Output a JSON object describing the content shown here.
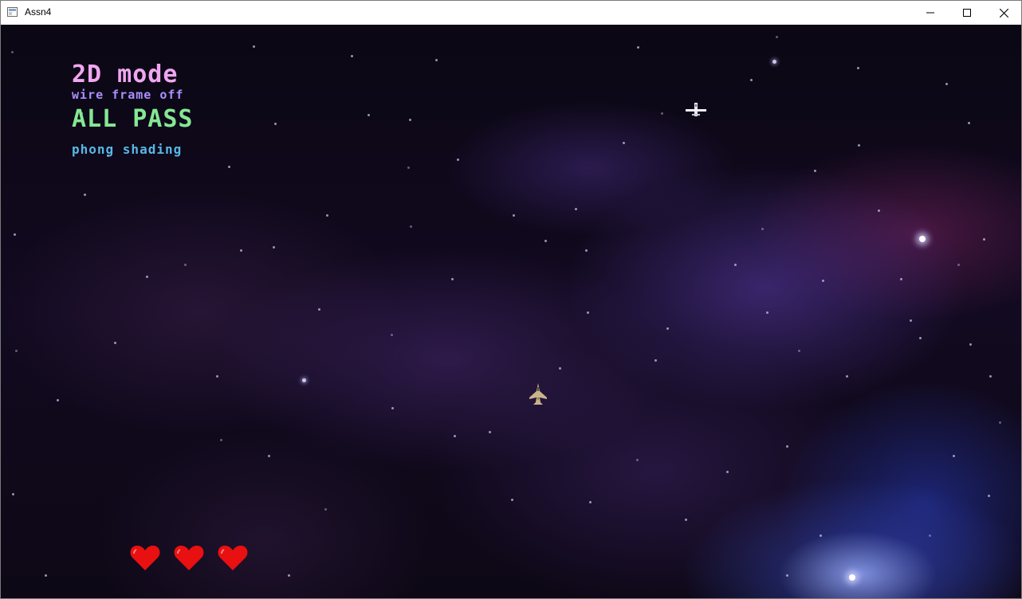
{
  "window": {
    "title": "Assn4",
    "controls": [
      "minimize",
      "maximize",
      "close"
    ]
  },
  "hud": {
    "mode": "2D mode",
    "wireframe": "wire frame off",
    "pass": "ALL PASS",
    "shading": "phong shading"
  },
  "lives": 3,
  "colors": {
    "mode_text": "#f0a6f0",
    "wireframe_text": "#a890ff",
    "pass_text": "#84e894",
    "shading_text": "#58b8e6",
    "heart": "#e81010",
    "space_bg": "#0d0816"
  },
  "icons": {
    "app": "window-icon",
    "minimize": "minimize-icon",
    "maximize": "maximize-icon",
    "close": "close-icon",
    "life": "heart-icon",
    "player": "player-ship-icon",
    "enemy": "enemy-ship-icon"
  }
}
